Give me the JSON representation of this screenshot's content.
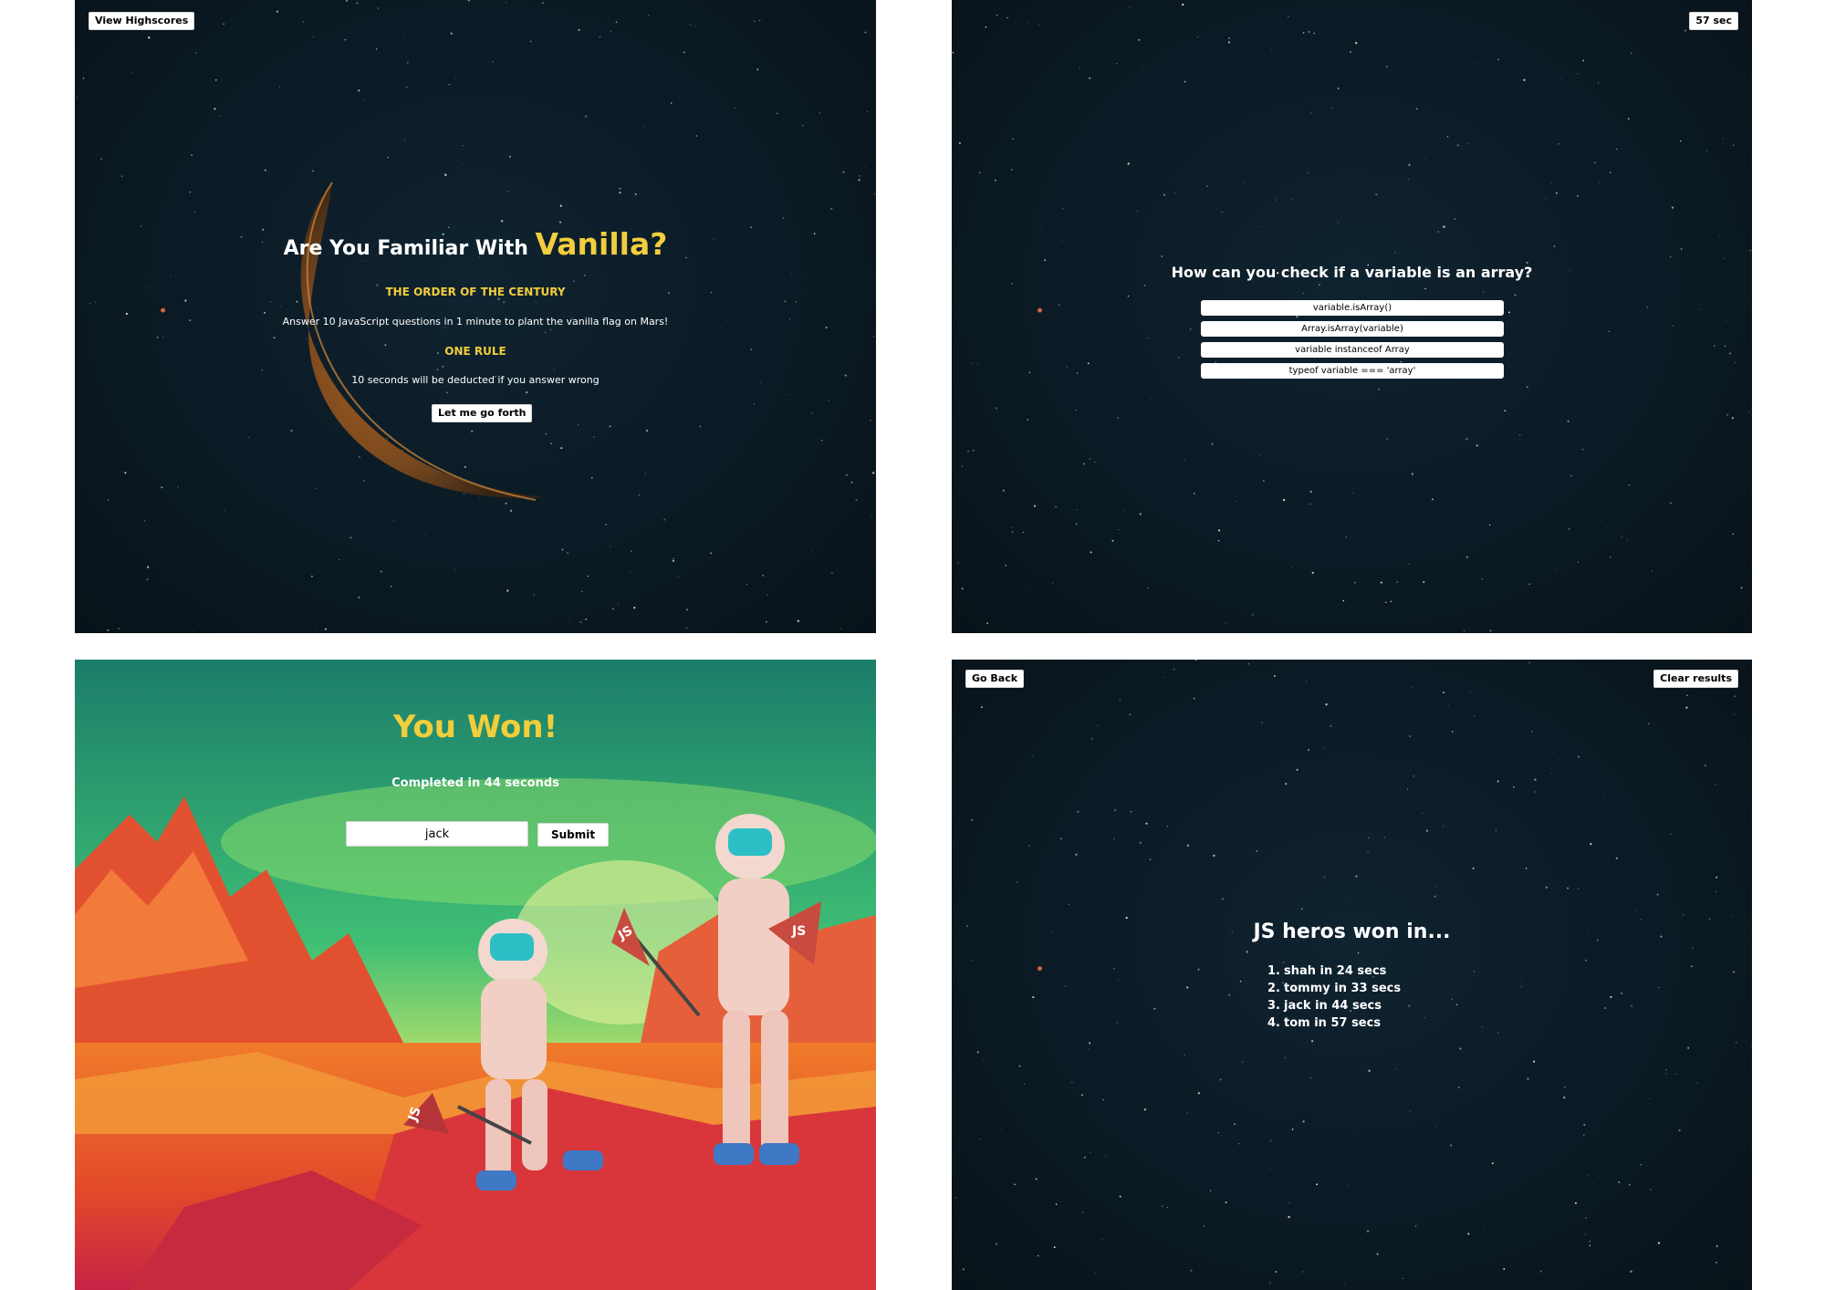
{
  "start_screen": {
    "highscores_button": "View Highscores",
    "title_prefix": "Are You Familiar With",
    "title_highlight": "Vanilla?",
    "subtitle1": "THE ORDER OF THE CENTURY",
    "description1": "Answer 10 JavaScript questions in 1 minute to plant the vanilla flag on Mars!",
    "subtitle2": "ONE RULE",
    "description2": "10 seconds will be deducted if you answer wrong",
    "start_button": "Let me go forth"
  },
  "quiz_screen": {
    "timer": "57 sec",
    "question": "How can you check if a variable is an array?",
    "choices": [
      "variable.isArray()",
      "Array.isArray(variable)",
      "variable instanceof Array",
      "typeof variable === 'array'"
    ]
  },
  "win_screen": {
    "heading": "You Won!",
    "completed_text": "Completed in 44 seconds",
    "name_input_value": "jack",
    "submit_button": "Submit",
    "flag_label": "JS"
  },
  "highscores_screen": {
    "go_back_button": "Go Back",
    "clear_button": "Clear results",
    "heading": "JS heros won in...",
    "scores": [
      {
        "rank": "1.",
        "text": "shah in 24 secs"
      },
      {
        "rank": "2.",
        "text": "tommy in 33 secs"
      },
      {
        "rank": "3.",
        "text": "jack in 44 secs"
      },
      {
        "rank": "4.",
        "text": "tom in 57 secs"
      }
    ]
  },
  "colors": {
    "space_background": "#0b1a24",
    "accent_yellow": "#f2cd3c",
    "button_white": "#ffffff"
  }
}
